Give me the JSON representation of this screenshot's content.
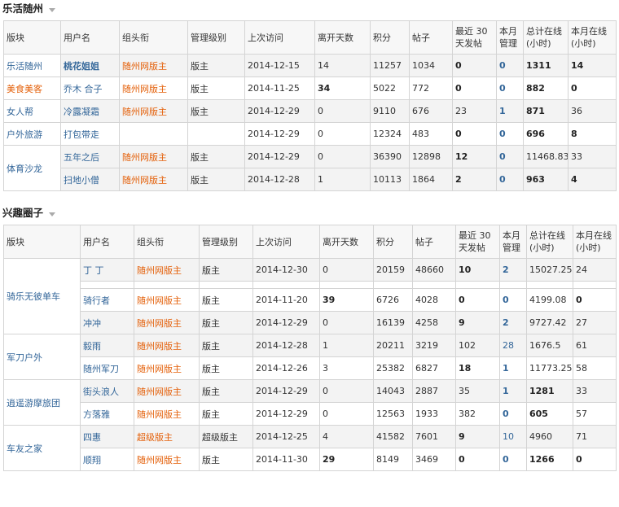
{
  "headers": [
    "版块",
    "用户名",
    "组头衔",
    "管理级别",
    "上次访问",
    "离开天数",
    "积分",
    "帖子",
    "最近 30 天发帖",
    "本月管理",
    "总计在线(小时)",
    "本月在线(小时)"
  ],
  "section1": {
    "title": "乐活随州",
    "rows": [
      {
        "board": "乐活随州",
        "user": "桃花姐姐",
        "group": "随州网版主",
        "level": "版主",
        "last": "2014-12-15",
        "away": "14",
        "points": "11257",
        "posts": "1034",
        "recent": "0",
        "manage": "0",
        "total": "1311",
        "month": "14"
      },
      {
        "board": "美食美客",
        "user": "乔木 合子",
        "group": "随州网版主",
        "level": "版主",
        "last": "2014-11-25",
        "away": "34",
        "points": "5022",
        "posts": "772",
        "recent": "0",
        "manage": "0",
        "total": "882",
        "month": "0"
      },
      {
        "board": "女人帮",
        "user": "冷露凝霜",
        "group": "随州网版主",
        "level": "版主",
        "last": "2014-12-29",
        "away": "0",
        "points": "9110",
        "posts": "676",
        "recent": "23",
        "manage": "1",
        "total": "871",
        "month": "36"
      },
      {
        "board": "户外旅游",
        "user": "打包带走",
        "group": "",
        "level": "",
        "last": "2014-12-29",
        "away": "0",
        "points": "12324",
        "posts": "483",
        "recent": "0",
        "manage": "0",
        "total": "696",
        "month": "8"
      },
      {
        "board": "体育沙龙",
        "user": "五年之后",
        "group": "随州网版主",
        "level": "版主",
        "last": "2014-12-29",
        "away": "0",
        "points": "36390",
        "posts": "12898",
        "recent": "12",
        "manage": "0",
        "total": "11468.83",
        "month": "33"
      },
      {
        "board": "",
        "user": "扫地小僧",
        "group": "随州网版主",
        "level": "版主",
        "last": "2014-12-28",
        "away": "1",
        "points": "10113",
        "posts": "1864",
        "recent": "2",
        "manage": "0",
        "total": "963",
        "month": "4"
      }
    ]
  },
  "section2": {
    "title": "兴趣圈子",
    "rows": [
      {
        "board": "骑乐无彼单车",
        "user": "丁 丁",
        "group": "随州网版主",
        "level": "版主",
        "last": "2014-12-30",
        "away": "0",
        "points": "20159",
        "posts": "48660",
        "recent": "10",
        "manage": "2",
        "total": "15027.25",
        "month": "24"
      },
      {
        "board": "",
        "user": "骑行者",
        "group": "随州网版主",
        "level": "版主",
        "last": "2014-11-20",
        "away": "39",
        "points": "6726",
        "posts": "4028",
        "recent": "0",
        "manage": "0",
        "total": "4199.08",
        "month": "0"
      },
      {
        "board": "",
        "user": "冲冲",
        "group": "随州网版主",
        "level": "版主",
        "last": "2014-12-29",
        "away": "0",
        "points": "16139",
        "posts": "4258",
        "recent": "9",
        "manage": "2",
        "total": "9727.42",
        "month": "27"
      },
      {
        "board": "军刀户外",
        "user": "毅雨",
        "group": "随州网版主",
        "level": "版主",
        "last": "2014-12-28",
        "away": "1",
        "points": "20211",
        "posts": "3219",
        "recent": "102",
        "manage": "28",
        "total": "1676.5",
        "month": "61"
      },
      {
        "board": "",
        "user": "随州军刀",
        "group": "随州网版主",
        "level": "版主",
        "last": "2014-12-26",
        "away": "3",
        "points": "25382",
        "posts": "6827",
        "recent": "18",
        "manage": "1",
        "total": "11773.25",
        "month": "58"
      },
      {
        "board": "逍遥游摩旅团",
        "user": "街头浪人",
        "group": "随州网版主",
        "level": "版主",
        "last": "2014-12-29",
        "away": "0",
        "points": "14043",
        "posts": "2887",
        "recent": "35",
        "manage": "1",
        "total": "1281",
        "month": "33"
      },
      {
        "board": "",
        "user": "方落雅",
        "group": "随州网版主",
        "level": "版主",
        "last": "2014-12-29",
        "away": "0",
        "points": "12563",
        "posts": "1933",
        "recent": "382",
        "manage": "0",
        "total": "605",
        "month": "57"
      },
      {
        "board": "车友之家",
        "user": "四惠",
        "group": "超级版主",
        "level": "超级版主",
        "last": "2014-12-25",
        "away": "4",
        "points": "41582",
        "posts": "7601",
        "recent": "9",
        "manage": "10",
        "total": "4960",
        "month": "71"
      },
      {
        "board": "",
        "user": "顺翔",
        "group": "随州网版主",
        "level": "版主",
        "last": "2014-11-30",
        "away": "29",
        "points": "8149",
        "posts": "3469",
        "recent": "0",
        "manage": "0",
        "total": "1266",
        "month": "0"
      }
    ]
  }
}
